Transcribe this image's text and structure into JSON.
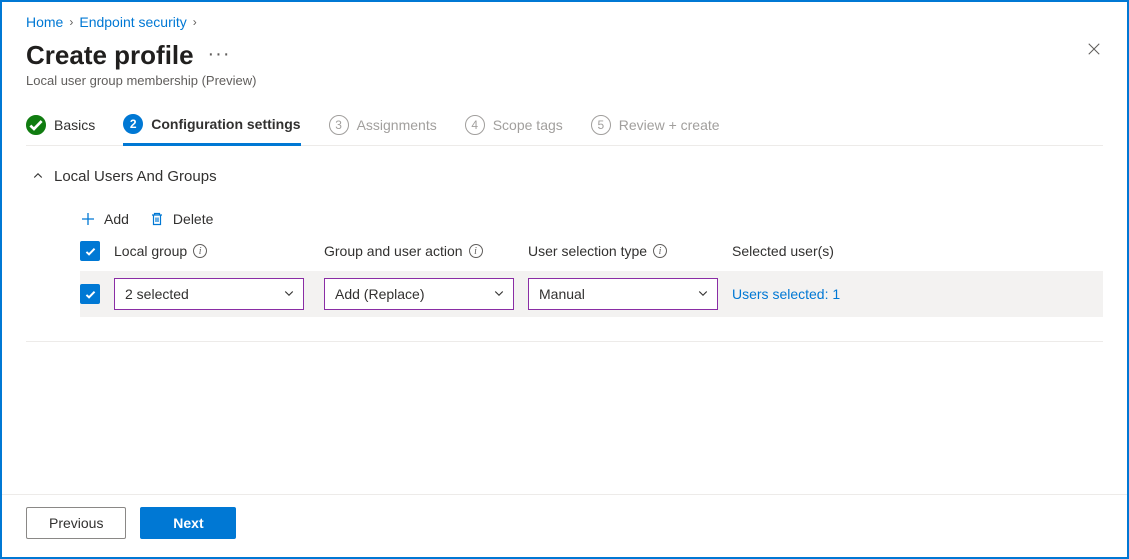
{
  "breadcrumb": {
    "home": "Home",
    "endpoint_security": "Endpoint security"
  },
  "header": {
    "title": "Create profile",
    "ellipsis": "···",
    "subtitle": "Local user group membership (Preview)"
  },
  "steps": {
    "s1": {
      "label": "Basics"
    },
    "s2": {
      "num": "2",
      "label": "Configuration settings"
    },
    "s3": {
      "num": "3",
      "label": "Assignments"
    },
    "s4": {
      "num": "4",
      "label": "Scope tags"
    },
    "s5": {
      "num": "5",
      "label": "Review + create"
    }
  },
  "section": {
    "title": "Local Users And Groups"
  },
  "toolbar": {
    "add": "Add",
    "delete": "Delete"
  },
  "columns": {
    "local_group": "Local group",
    "group_user_action": "Group and user action",
    "user_selection_type": "User selection type",
    "selected_users": "Selected user(s)"
  },
  "row": {
    "local_group_value": "2 selected",
    "action_value": "Add (Replace)",
    "selection_type_value": "Manual",
    "users_selected": "Users selected: 1"
  },
  "footer": {
    "previous": "Previous",
    "next": "Next"
  }
}
